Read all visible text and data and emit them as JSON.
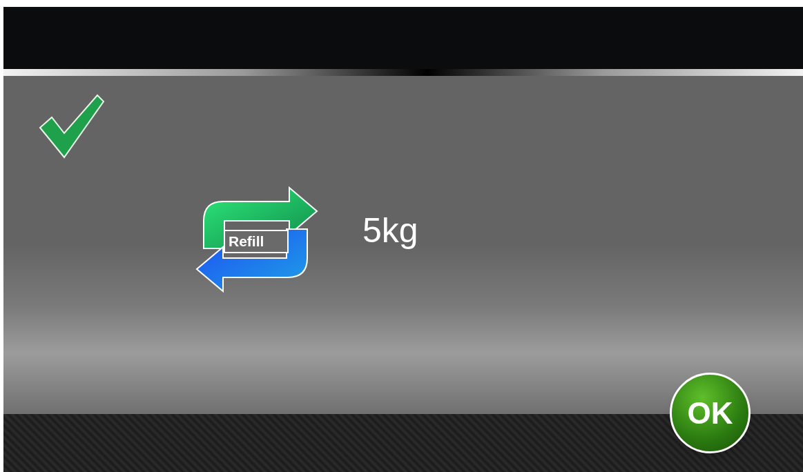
{
  "refill": {
    "label": "Refill",
    "amount": "5kg"
  },
  "ok_button": {
    "label": "OK"
  }
}
